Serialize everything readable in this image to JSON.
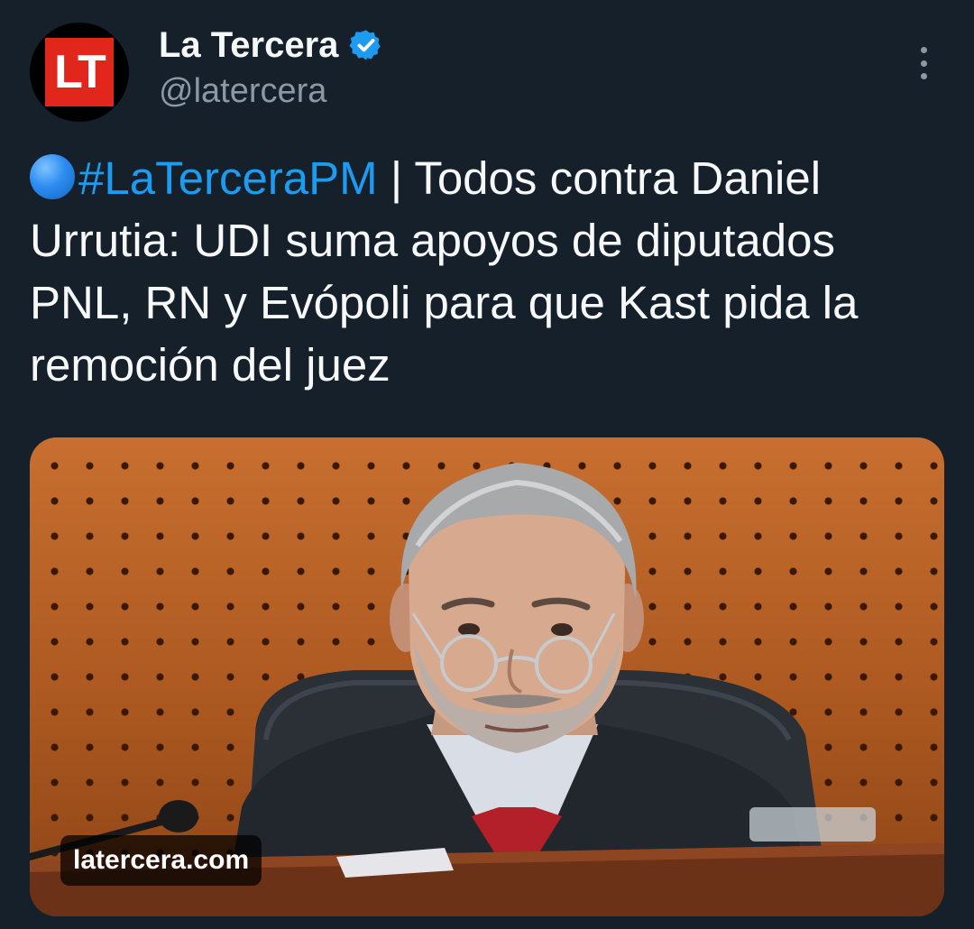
{
  "author": {
    "avatar_text": "LT",
    "display_name": "La Tercera",
    "handle": "@latercera",
    "verified": true
  },
  "tweet": {
    "emoji": "blue-circle",
    "hashtag": "#LaTerceraPM",
    "body": " | Todos contra Daniel Urrutia: UDI suma apoyos de diputados PNL, RN y Evópoli para que Kast pida la remoción del juez"
  },
  "media": {
    "link_domain": "latercera.com"
  },
  "colors": {
    "background": "#15202b",
    "accent": "#1d9bf0",
    "brand_red": "#e1261c",
    "secondary_text": "#8b98a5"
  }
}
